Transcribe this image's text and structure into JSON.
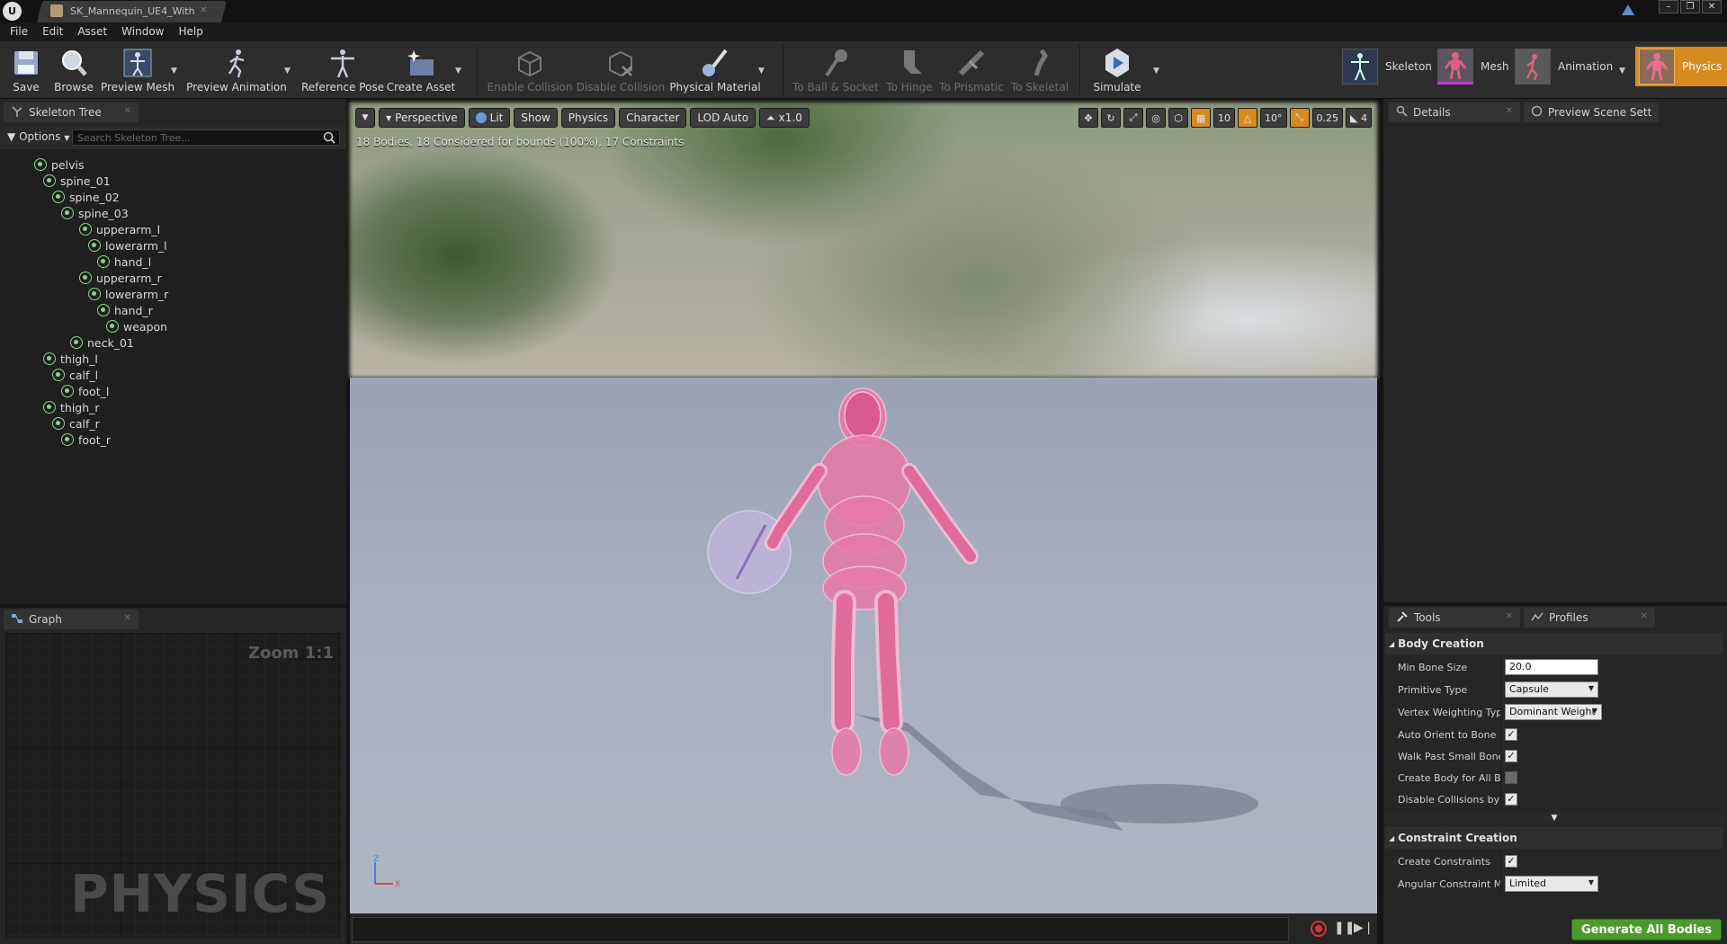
{
  "titlebar": {
    "document_tab": "SK_Mannequin_UE4_With",
    "ue_logo": "U",
    "window_buttons": {
      "minimize": "–",
      "restore": "❐",
      "close": "✕"
    }
  },
  "menu": [
    "File",
    "Edit",
    "Asset",
    "Window",
    "Help"
  ],
  "toolbar": {
    "save": "Save",
    "browse": "Browse",
    "preview_mesh": "Preview Mesh",
    "preview_animation": "Preview Animation",
    "reference_pose": "Reference Pose",
    "create_asset": "Create Asset",
    "enable_collision": "Enable Collision",
    "disable_collision": "Disable Collision",
    "physical_material": "Physical Material",
    "to_ball_socket": "To Ball & Socket",
    "to_hinge": "To Hinge",
    "to_prismatic": "To Prismatic",
    "to_skeletal": "To Skeletal",
    "simulate": "Simulate"
  },
  "modes": {
    "skeleton": "Skeleton",
    "mesh": "Mesh",
    "animation": "Animation",
    "physics": "Physics",
    "active": "Physics"
  },
  "skeleton_tree": {
    "tab": "Skeleton Tree",
    "options": "Options",
    "search_placeholder": "Search Skeleton Tree...",
    "bones": [
      {
        "name": "pelvis",
        "depth": 0
      },
      {
        "name": "spine_01",
        "depth": 1
      },
      {
        "name": "spine_02",
        "depth": 2
      },
      {
        "name": "spine_03",
        "depth": 3
      },
      {
        "name": "upperarm_l",
        "depth": 5
      },
      {
        "name": "lowerarm_l",
        "depth": 6
      },
      {
        "name": "hand_l",
        "depth": 7
      },
      {
        "name": "upperarm_r",
        "depth": 5
      },
      {
        "name": "lowerarm_r",
        "depth": 6
      },
      {
        "name": "hand_r",
        "depth": 7
      },
      {
        "name": "weapon",
        "depth": 8
      },
      {
        "name": "neck_01",
        "depth": 4
      },
      {
        "name": "thigh_l",
        "depth": 1
      },
      {
        "name": "calf_l",
        "depth": 2
      },
      {
        "name": "foot_l",
        "depth": 3
      },
      {
        "name": "thigh_r",
        "depth": 1
      },
      {
        "name": "calf_r",
        "depth": 2
      },
      {
        "name": "foot_r",
        "depth": 3
      }
    ]
  },
  "graph": {
    "tab": "Graph",
    "zoom": "Zoom 1:1",
    "watermark": "PHYSICS"
  },
  "viewport": {
    "perspective": "Perspective",
    "lit": "Lit",
    "show": "Show",
    "physics": "Physics",
    "character": "Character",
    "lod": "LOD Auto",
    "speed": "x1.0",
    "grid_snap": "10",
    "rotation_snap": "10°",
    "scale_snap": "0.25",
    "camera_speed": "4",
    "info": "18 Bodies, 18 Considered for bounds (100%), 17 Constraints",
    "axis_z": "Z",
    "axis_x": "X"
  },
  "details": {
    "tab": "Details",
    "preview_tab": "Preview Scene Sett"
  },
  "tools": {
    "tab": "Tools",
    "profiles_tab": "Profiles",
    "body_creation": "Body Creation",
    "min_bone_size_label": "Min Bone Size",
    "min_bone_size": "20.0",
    "primitive_type_label": "Primitive Type",
    "primitive_type": "Capsule",
    "vertex_weighting_label": "Vertex Weighting Type",
    "vertex_weighting": "Dominant Weight",
    "auto_orient_label": "Auto Orient to Bone",
    "walk_past_label": "Walk Past Small Bones",
    "create_body_all_label": "Create Body for All Bones",
    "disable_collisions_label": "Disable Collisions by Default",
    "constraint_creation": "Constraint Creation",
    "create_constraints_label": "Create Constraints",
    "angular_constraint_label": "Angular Constraint Mode",
    "angular_constraint": "Limited",
    "generate": "Generate All Bodies",
    "checkbox_states": {
      "auto_orient": true,
      "walk_past": true,
      "create_body_all": false,
      "disable_collisions": true,
      "create_constraints": true
    }
  },
  "colors": {
    "accent": "#d98a1f",
    "generate_button": "#4a9b2b",
    "bone_icon": "#8fd18f",
    "mannequin": "#e06fa0"
  }
}
